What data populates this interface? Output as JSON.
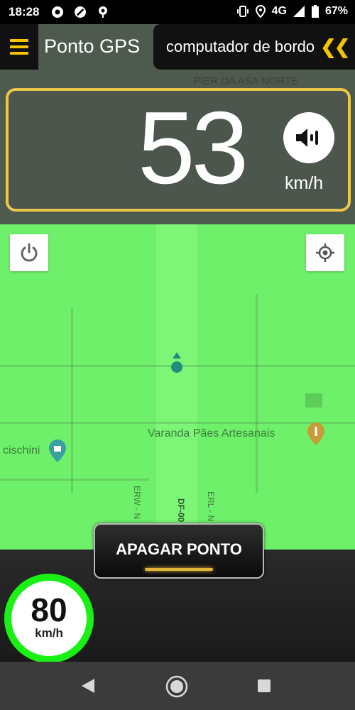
{
  "status_bar": {
    "time": "18:28",
    "network": "4G",
    "battery": "67%",
    "icons": [
      "record-icon",
      "no-signal-icon",
      "location-pin-icon",
      "vibrate-icon",
      "location-icon",
      "signal-icon",
      "battery-icon"
    ]
  },
  "header": {
    "menu_icon": "hamburger-menu-icon",
    "title": "Ponto GPS",
    "computer_label": "computador de bordo",
    "computer_icon": "double-chevron-left-icon"
  },
  "speed_panel": {
    "speed": "53",
    "unit": "km/h",
    "sound_icon": "speaker-icon"
  },
  "map": {
    "labels": {
      "pier": "PIER DA ASA NORTE",
      "varanda": "Varanda Pães Artesanais",
      "cischini": "cischini",
      "erw": "ERW - N",
      "df": "DF-00",
      "erl": "ERL - N"
    },
    "power_icon": "power-icon",
    "locate_icon": "crosshair-icon"
  },
  "clear_button": {
    "label": "APAGAR PONTO"
  },
  "speed_limit": {
    "value": "80",
    "unit": "km/h"
  },
  "nav_bar": {
    "icons": [
      "back-icon",
      "home-icon",
      "recents-icon"
    ]
  },
  "colors": {
    "accent": "#f4c400",
    "map_green": "#6ff06a",
    "limit_ring": "#19f013",
    "panel_border": "#e9c74a"
  }
}
